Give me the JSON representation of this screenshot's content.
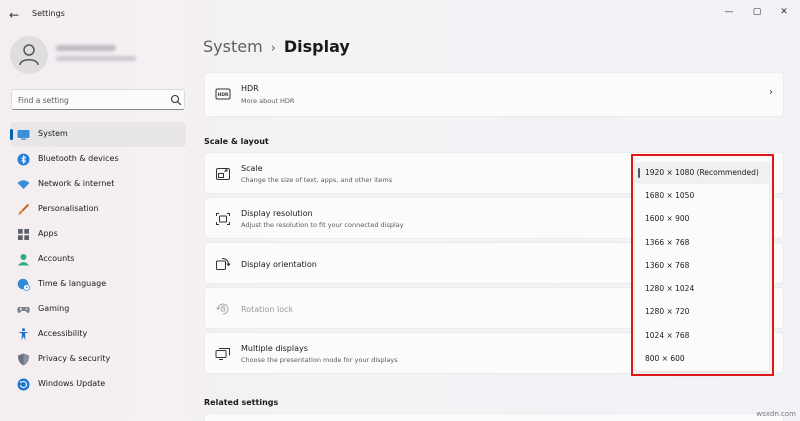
{
  "window": {
    "title": "Settings",
    "controls": {
      "minimize": "—",
      "maximize": "▢",
      "close": "✕"
    }
  },
  "search": {
    "placeholder": "Find a setting"
  },
  "sidebar": {
    "items": [
      {
        "label": "System",
        "icon": "monitor-icon",
        "active": true
      },
      {
        "label": "Bluetooth & devices",
        "icon": "bluetooth-icon"
      },
      {
        "label": "Network & internet",
        "icon": "wifi-icon"
      },
      {
        "label": "Personalisation",
        "icon": "brush-icon"
      },
      {
        "label": "Apps",
        "icon": "apps-icon"
      },
      {
        "label": "Accounts",
        "icon": "person-icon"
      },
      {
        "label": "Time & language",
        "icon": "globe-clock-icon"
      },
      {
        "label": "Gaming",
        "icon": "gamepad-icon"
      },
      {
        "label": "Accessibility",
        "icon": "accessibility-icon"
      },
      {
        "label": "Privacy & security",
        "icon": "shield-icon"
      },
      {
        "label": "Windows Update",
        "icon": "update-icon"
      }
    ]
  },
  "breadcrumb": {
    "parent": "System",
    "separator": "›",
    "current": "Display"
  },
  "cards": {
    "hdr": {
      "title": "HDR",
      "subtitle": "More about HDR"
    },
    "scale": {
      "title": "Scale",
      "subtitle": "Change the size of text, apps, and other items"
    },
    "resolution": {
      "title": "Display resolution",
      "subtitle": "Adjust the resolution to fit your connected display"
    },
    "orientation": {
      "title": "Display orientation"
    },
    "rotation": {
      "title": "Rotation lock"
    },
    "multiple": {
      "title": "Multiple displays",
      "subtitle": "Choose the presentation mode for your displays"
    }
  },
  "sections": {
    "scale_layout": "Scale & layout",
    "related": "Related settings"
  },
  "resolution_dropdown": {
    "options": [
      "1920 × 1080 (Recommended)",
      "1680 × 1050",
      "1600 × 900",
      "1366 × 768",
      "1360 × 768",
      "1280 × 1024",
      "1280 × 720",
      "1024 × 768",
      "800 × 600"
    ],
    "selected": "1920 × 1080 (Recommended)"
  },
  "colors": {
    "accent": "#0063b1",
    "highlight_border": "#e21818"
  },
  "watermark": "wsxdn.com"
}
